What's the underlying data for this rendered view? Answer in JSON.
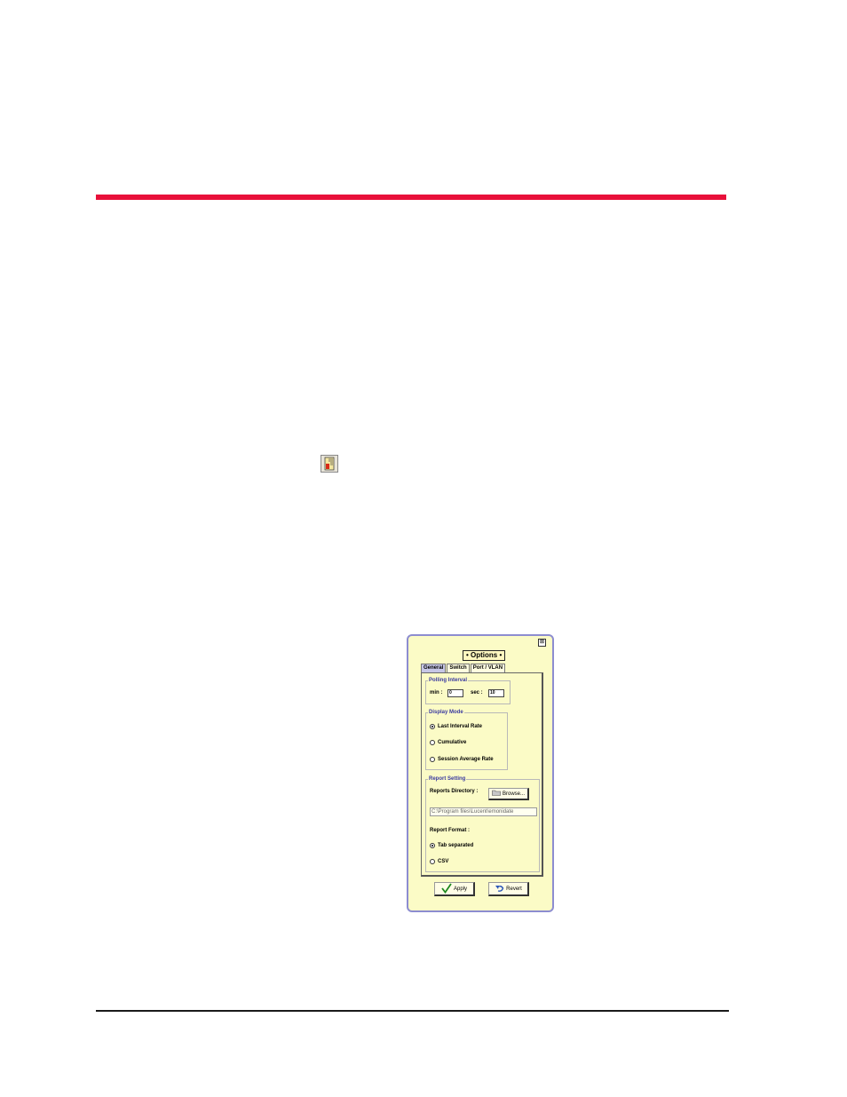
{
  "doc": {
    "accent_color": "#e8103a"
  },
  "dialog": {
    "title": "• Options •",
    "close_symbol": "⊠",
    "tabs": [
      {
        "label": "General",
        "active": true
      },
      {
        "label": "Switch",
        "active": false
      },
      {
        "label": "Port / VLAN",
        "active": false
      }
    ],
    "polling": {
      "group_label": "Polling Interval",
      "min_label": "min :",
      "min_value": "0",
      "sec_label": "sec :",
      "sec_value": "10"
    },
    "display_mode": {
      "group_label": "Display Mode",
      "options": [
        {
          "label": "Last Interval Rate",
          "selected": true
        },
        {
          "label": "Cumulative",
          "selected": false
        },
        {
          "label": "Session Average Rate",
          "selected": false
        }
      ]
    },
    "report_setting": {
      "group_label": "Report Setting",
      "directory_label": "Reports Directory :",
      "browse_label": "Browse...",
      "directory_path": "C:\\Program files\\Lucent\\emonidate",
      "format_label": "Report Format :",
      "formats": [
        {
          "label": "Tab separated",
          "selected": true
        },
        {
          "label": "CSV",
          "selected": false
        }
      ]
    },
    "apply_label": "Apply",
    "revert_label": "Revert",
    "icons": {
      "apply": "check-icon",
      "revert": "undo-icon",
      "browse": "folder-icon",
      "report": "report-icon"
    }
  }
}
